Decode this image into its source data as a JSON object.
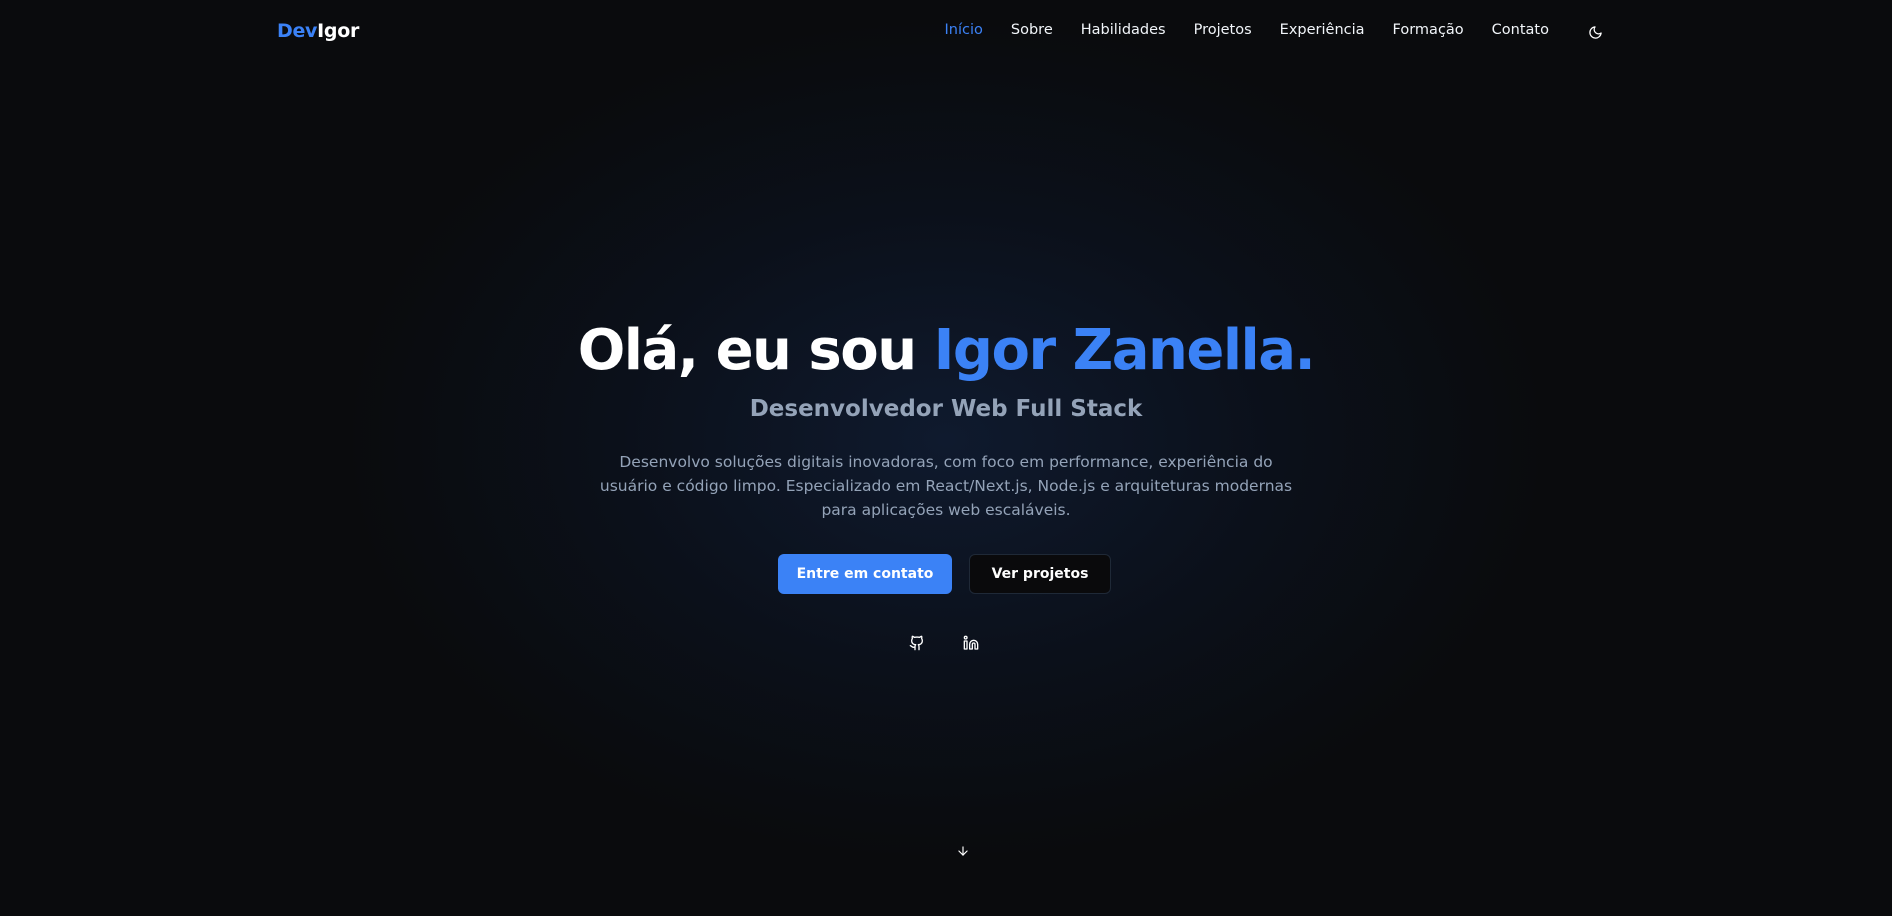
{
  "logo": {
    "part1": "Dev",
    "part2": "Igor"
  },
  "nav": {
    "items": [
      {
        "label": "Início",
        "active": true
      },
      {
        "label": "Sobre",
        "active": false
      },
      {
        "label": "Habilidades",
        "active": false
      },
      {
        "label": "Projetos",
        "active": false
      },
      {
        "label": "Experiência",
        "active": false
      },
      {
        "label": "Formação",
        "active": false
      },
      {
        "label": "Contato",
        "active": false
      }
    ],
    "theme_icon": "moon-icon"
  },
  "hero": {
    "title_prefix": "Olá, eu sou ",
    "title_name": "Igor Zanella.",
    "subtitle": "Desenvolvedor Web Full Stack",
    "description": "Desenvolvo soluções digitais inovadoras, com foco em performance, experiência do usuário e código limpo. Especializado em React/Next.js, Node.js e arquiteturas modernas para aplicações web escaláveis.",
    "primary_button": "Entre em contato",
    "secondary_button": "Ver projetos",
    "social": [
      "github-icon",
      "linkedin-icon"
    ],
    "scroll_icon": "arrow-down-icon"
  },
  "colors": {
    "accent": "#3b82f6",
    "background": "#0a0b0d",
    "muted_text": "#94a3b8"
  }
}
